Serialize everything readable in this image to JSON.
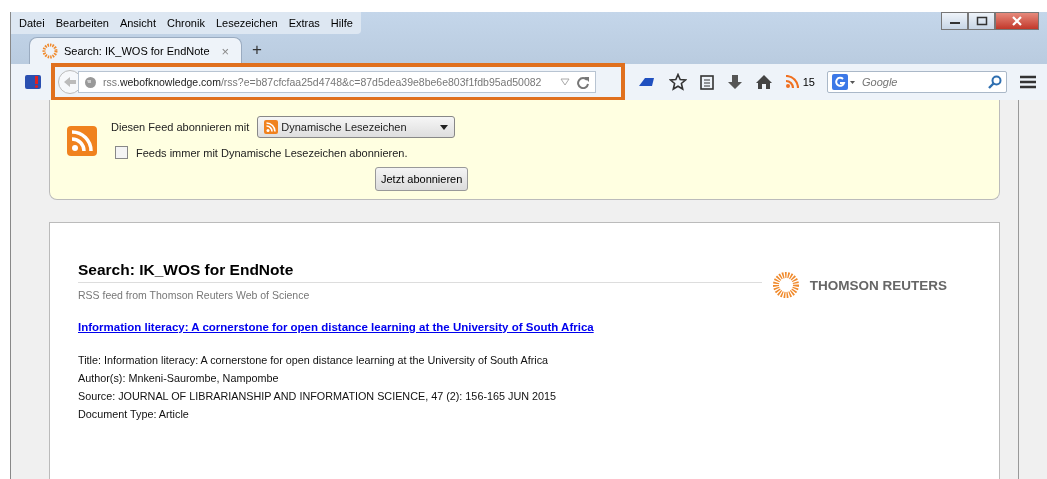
{
  "menu_bar": [
    "Datei",
    "Bearbeiten",
    "Ansicht",
    "Chronik",
    "Lesezeichen",
    "Extras",
    "Hilfe"
  ],
  "tabs": [
    {
      "label": "Search: IK_WOS for EndNote",
      "selected": true,
      "close": "×"
    }
  ],
  "new_tab": "+",
  "address_bar": {
    "prefix": "rss.",
    "domain": "webofknowledge.com",
    "path": "/rss?e=b87cfcfaa25d4748&c=87d5dea39e8be6e803f1fdb95ad50082",
    "highlighted": true
  },
  "feed_count": "15",
  "search": {
    "placeholder": "Google"
  },
  "subscribe": {
    "label": "Diesen Feed abonnieren mit",
    "reader": "Dynamische Lesezeichen",
    "always_label": "Feeds immer mit Dynamische Lesezeichen abonnieren.",
    "always_checked": false,
    "button": "Jetzt abonnieren"
  },
  "feed": {
    "title": "Search: IK_WOS for EndNote",
    "subtitle": "RSS feed from Thomson Reuters Web of Science",
    "brand": "THOMSON REUTERS",
    "entries": [
      {
        "link": "Information literacy: A cornerstone for open distance learning at the University of South Africa",
        "lines": [
          "Title: Information literacy: A cornerstone for open distance learning at the University of South Africa",
          "Author(s): Mnkeni-Saurombe, Nampombe",
          "Source: JOURNAL OF LIBRARIANSHIP AND INFORMATION SCIENCE, 47 (2): 156-165 JUN 2015",
          "Document Type: Article"
        ]
      }
    ]
  }
}
